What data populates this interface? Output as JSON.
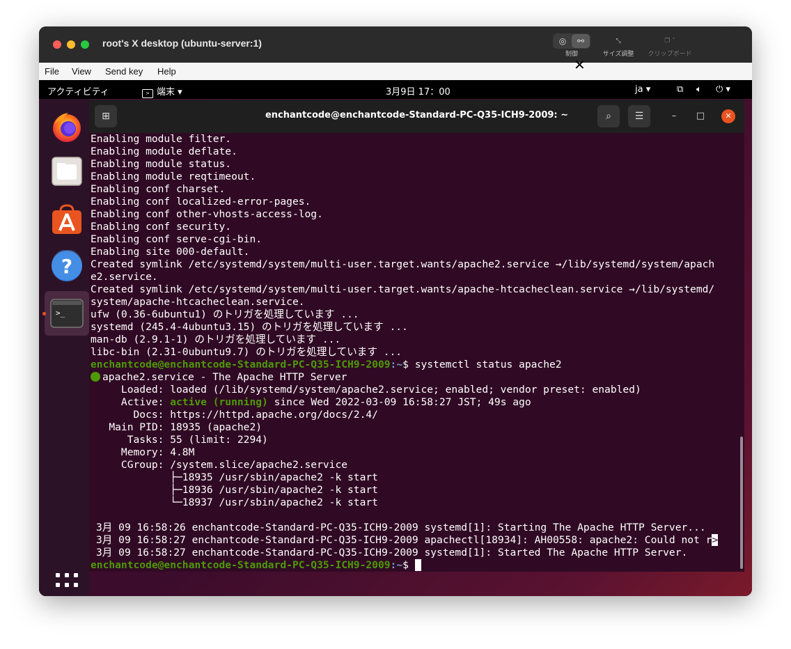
{
  "window": {
    "title": "root's X desktop (ubuntu-server:1)"
  },
  "toolbar": {
    "control_label": "制御",
    "resize_label": "サイズ調整",
    "clipboard_label": "クリップボード"
  },
  "menu": [
    "File",
    "View",
    "Send key",
    "Help"
  ],
  "topbar": {
    "activities": "アクティビティ",
    "app": "端末 ▾",
    "clock": "3月9日  17：00",
    "lang": "ja ▾"
  },
  "terminal": {
    "title": "enchantcode@enchantcode-Standard-PC-Q35-ICH9-2009: ~",
    "prompt_user": "enchantcode@enchantcode-Standard-PC-Q35-ICH9-2009",
    "prompt_dir": ":~",
    "prompt_sign": "$ ",
    "command": "systemctl status apache2",
    "lines": [
      "Enabling module filter.",
      "Enabling module deflate.",
      "Enabling module status.",
      "Enabling module reqtimeout.",
      "Enabling conf charset.",
      "Enabling conf localized-error-pages.",
      "Enabling conf other-vhosts-access-log.",
      "Enabling conf security.",
      "Enabling conf serve-cgi-bin.",
      "Enabling site 000-default.",
      "Created symlink /etc/systemd/system/multi-user.target.wants/apache2.service →/lib/systemd/system/apach",
      "e2.service.",
      "Created symlink /etc/systemd/system/multi-user.target.wants/apache-htcacheclean.service →/lib/systemd/",
      "system/apache-htcacheclean.service.",
      "ufw (0.36-6ubuntu1) のトリガを処理しています ...",
      "systemd (245.4-4ubuntu3.15) のトリガを処理しています ...",
      "man-db (2.9.1-1) のトリガを処理しています ...",
      "libc-bin (2.31-0ubuntu9.7) のトリガを処理しています ..."
    ],
    "status": {
      "service_line": "apache2.service - The Apache HTTP Server",
      "loaded": "     Loaded: loaded (/lib/systemd/system/apache2.service; enabled; vendor preset: enabled)",
      "active_prefix": "     Active: ",
      "active_state": "active (running)",
      "active_suffix": " since Wed 2022-03-09 16:58:27 JST; 49s ago",
      "docs": "       Docs: https://httpd.apache.org/docs/2.4/",
      "main_pid": "   Main PID: 18935 (apache2)",
      "tasks": "      Tasks: 55 (limit: 2294)",
      "memory": "     Memory: 4.8M",
      "cgroup": "     CGroup: /system.slice/apache2.service",
      "tree": [
        "             ├─18935 /usr/sbin/apache2 -k start",
        "             ├─18936 /usr/sbin/apache2 -k start",
        "             └─18937 /usr/sbin/apache2 -k start"
      ],
      "log": [
        "3月 09 16:58:26 enchantcode-Standard-PC-Q35-ICH9-2009 systemd[1]: Starting The Apache HTTP Server...",
        "3月 09 16:58:27 enchantcode-Standard-PC-Q35-ICH9-2009 apachectl[18934]: AH00558: apache2: Could not r",
        "3月 09 16:58:27 enchantcode-Standard-PC-Q35-ICH9-2009 systemd[1]: Started The Apache HTTP Server."
      ],
      "truncation_marker": ">"
    }
  }
}
